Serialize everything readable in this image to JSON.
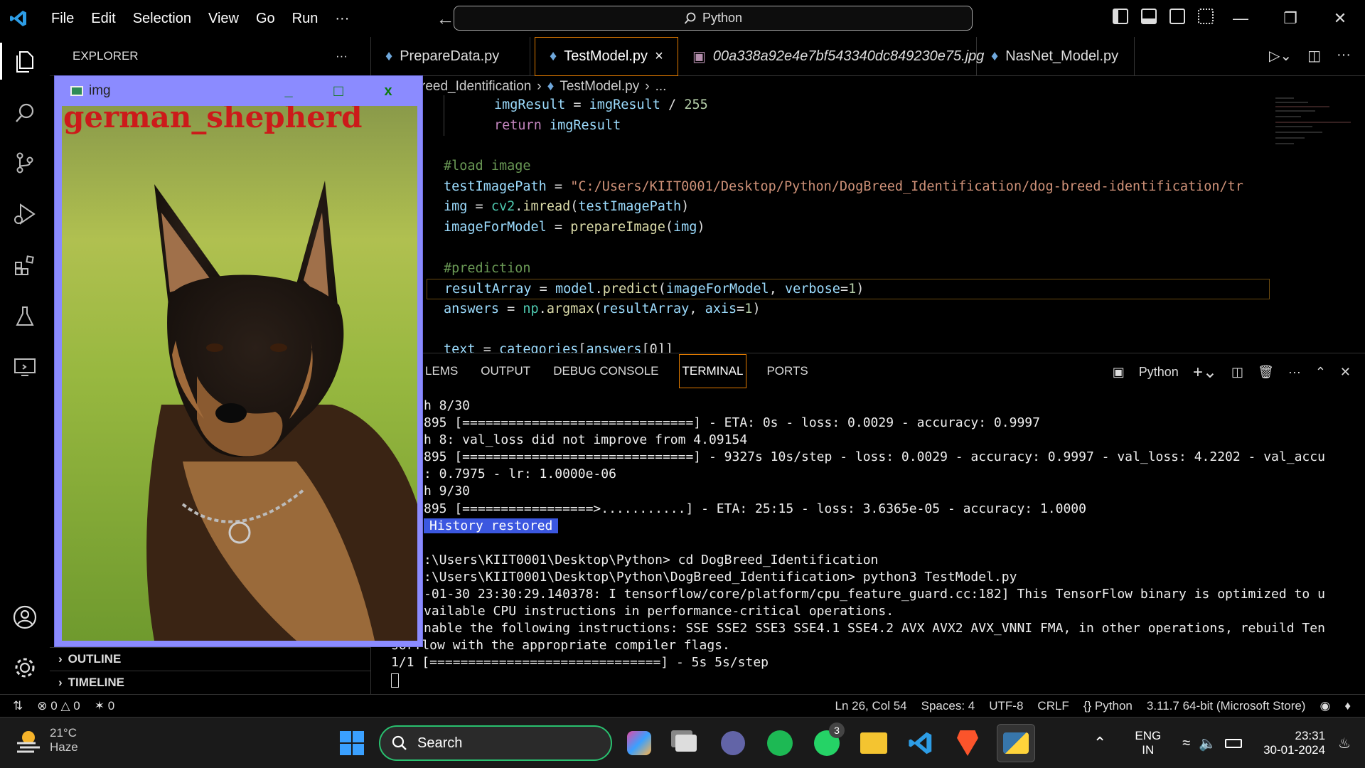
{
  "menu": [
    "File",
    "Edit",
    "Selection",
    "View",
    "Go",
    "Run",
    "···"
  ],
  "command_center": "Python",
  "sidebar": {
    "title": "EXPLORER",
    "more": "···",
    "outline": "OUTLINE",
    "timeline": "TIMELINE"
  },
  "img_window": {
    "title": "img",
    "min": "_",
    "max": "□",
    "close": "x",
    "overlay_text": "german_shepherd"
  },
  "tabs": [
    {
      "label": "PrepareData.py"
    },
    {
      "label": "TestModel.py",
      "close": "×"
    },
    {
      "label": "00a338a92e4e7bf543340dc849230e75.jpg"
    },
    {
      "label": "NasNet_Model.py"
    }
  ],
  "breadcrumb": {
    "folder": "reed_Identification",
    "file": "TestModel.py",
    "more": "..."
  },
  "code": {
    "l1_a": "imgResult",
    "l1_b": " = ",
    "l1_c": "imgResult",
    "l1_d": " / ",
    "l1_e": "255",
    "l2_a": "return",
    "l2_b": "imgResult",
    "l3": "#load image",
    "l4_a": "testImagePath",
    "l4_b": " = ",
    "l4_c": "\"C:/Users/KIIT0001/Desktop/Python/DogBreed_Identification/dog-breed-identification/tr",
    "l5_a": "img",
    "l5_b": " = ",
    "l5_c": "cv2",
    "l5_d": ".",
    "l5_e": "imread",
    "l5_f": "(",
    "l5_g": "testImagePath",
    "l5_h": ")",
    "l6_a": "imageForModel",
    "l6_b": " = ",
    "l6_c": "prepareImage",
    "l6_d": "(",
    "l6_e": "img",
    "l6_f": ")",
    "l7": "#prediction",
    "l8_a": "resultArray",
    "l8_b": " = ",
    "l8_c": "model",
    "l8_d": ".",
    "l8_e": "predict",
    "l8_f": "(",
    "l8_g": "imageForModel",
    "l8_h": ", ",
    "l8_i": "verbose",
    "l8_j": "=",
    "l8_k": "1",
    "l8_l": ")",
    "l9_a": "answers",
    "l9_b": " = ",
    "l9_c": "np",
    "l9_d": ".",
    "l9_e": "argmax",
    "l9_f": "(",
    "l9_g": "resultArray",
    "l9_h": ", ",
    "l9_i": "axis",
    "l9_j": "=",
    "l9_k": "1",
    "l9_l": ")",
    "l10_a": "text",
    "l10_b": " = ",
    "l10_c": "categories",
    "l10_d": "[",
    "l10_e": "answers",
    "l10_f": "[0]]"
  },
  "panel": {
    "tabs": [
      "LEMS",
      "OUTPUT",
      "DEBUG CONSOLE",
      "TERMINAL",
      "PORTS"
    ],
    "shell": "Python"
  },
  "terminal": [
    "h 8/30",
    "895 [==============================] - ETA: 0s - loss: 0.0029 - accuracy: 0.9997",
    "h 8: val_loss did not improve from 4.09154",
    "895 [==============================] - 9327s 10s/step - loss: 0.0029 - accuracy: 0.9997 - val_loss: 4.2202 - val_accu",
    ": 0.7975 - lr: 1.0000e-06",
    "h 9/30",
    "895 [=================>...........] - ETA: 25:15 - loss: 3.6365e-05 - accuracy: 1.0000",
    "History restored",
    "",
    ":\\Users\\KIIT0001\\Desktop\\Python> cd DogBreed_Identification",
    ":\\Users\\KIIT0001\\Desktop\\Python\\DogBreed_Identification> python3 TestModel.py",
    "-01-30 23:30:29.140378: I tensorflow/core/platform/cpu_feature_guard.cc:182] This TensorFlow binary is optimized to u",
    "vailable CPU instructions in performance-critical operations.",
    "nable the following instructions: SSE SSE2 SSE3 SSE4.1 SSE4.2 AVX AVX2 AVX_VNNI FMA, in other operations, rebuild Ten",
    "sorflow with the appropriate compiler flags.",
    "1/1 [==============================] - 5s 5s/step"
  ],
  "statusbar": {
    "errors": "0",
    "warnings": "0",
    "ports": "0",
    "position": "Ln 26, Col 54",
    "spaces": "Spaces: 4",
    "encoding": "UTF-8",
    "eol": "CRLF",
    "language": "Python",
    "interpreter": "3.11.7 64-bit (Microsoft Store)"
  },
  "taskbar": {
    "temp": "21°C",
    "weather": "Haze",
    "search": "Search",
    "whatsapp_badge": "3",
    "lang": "ENG",
    "region": "IN",
    "time": "23:31",
    "date": "30-01-2024"
  },
  "colors": {
    "accent": "#e07a00",
    "dog_label": "#cc1a1a",
    "img_frame": "#8b8bff",
    "term_highlight": "#3b57e0"
  }
}
